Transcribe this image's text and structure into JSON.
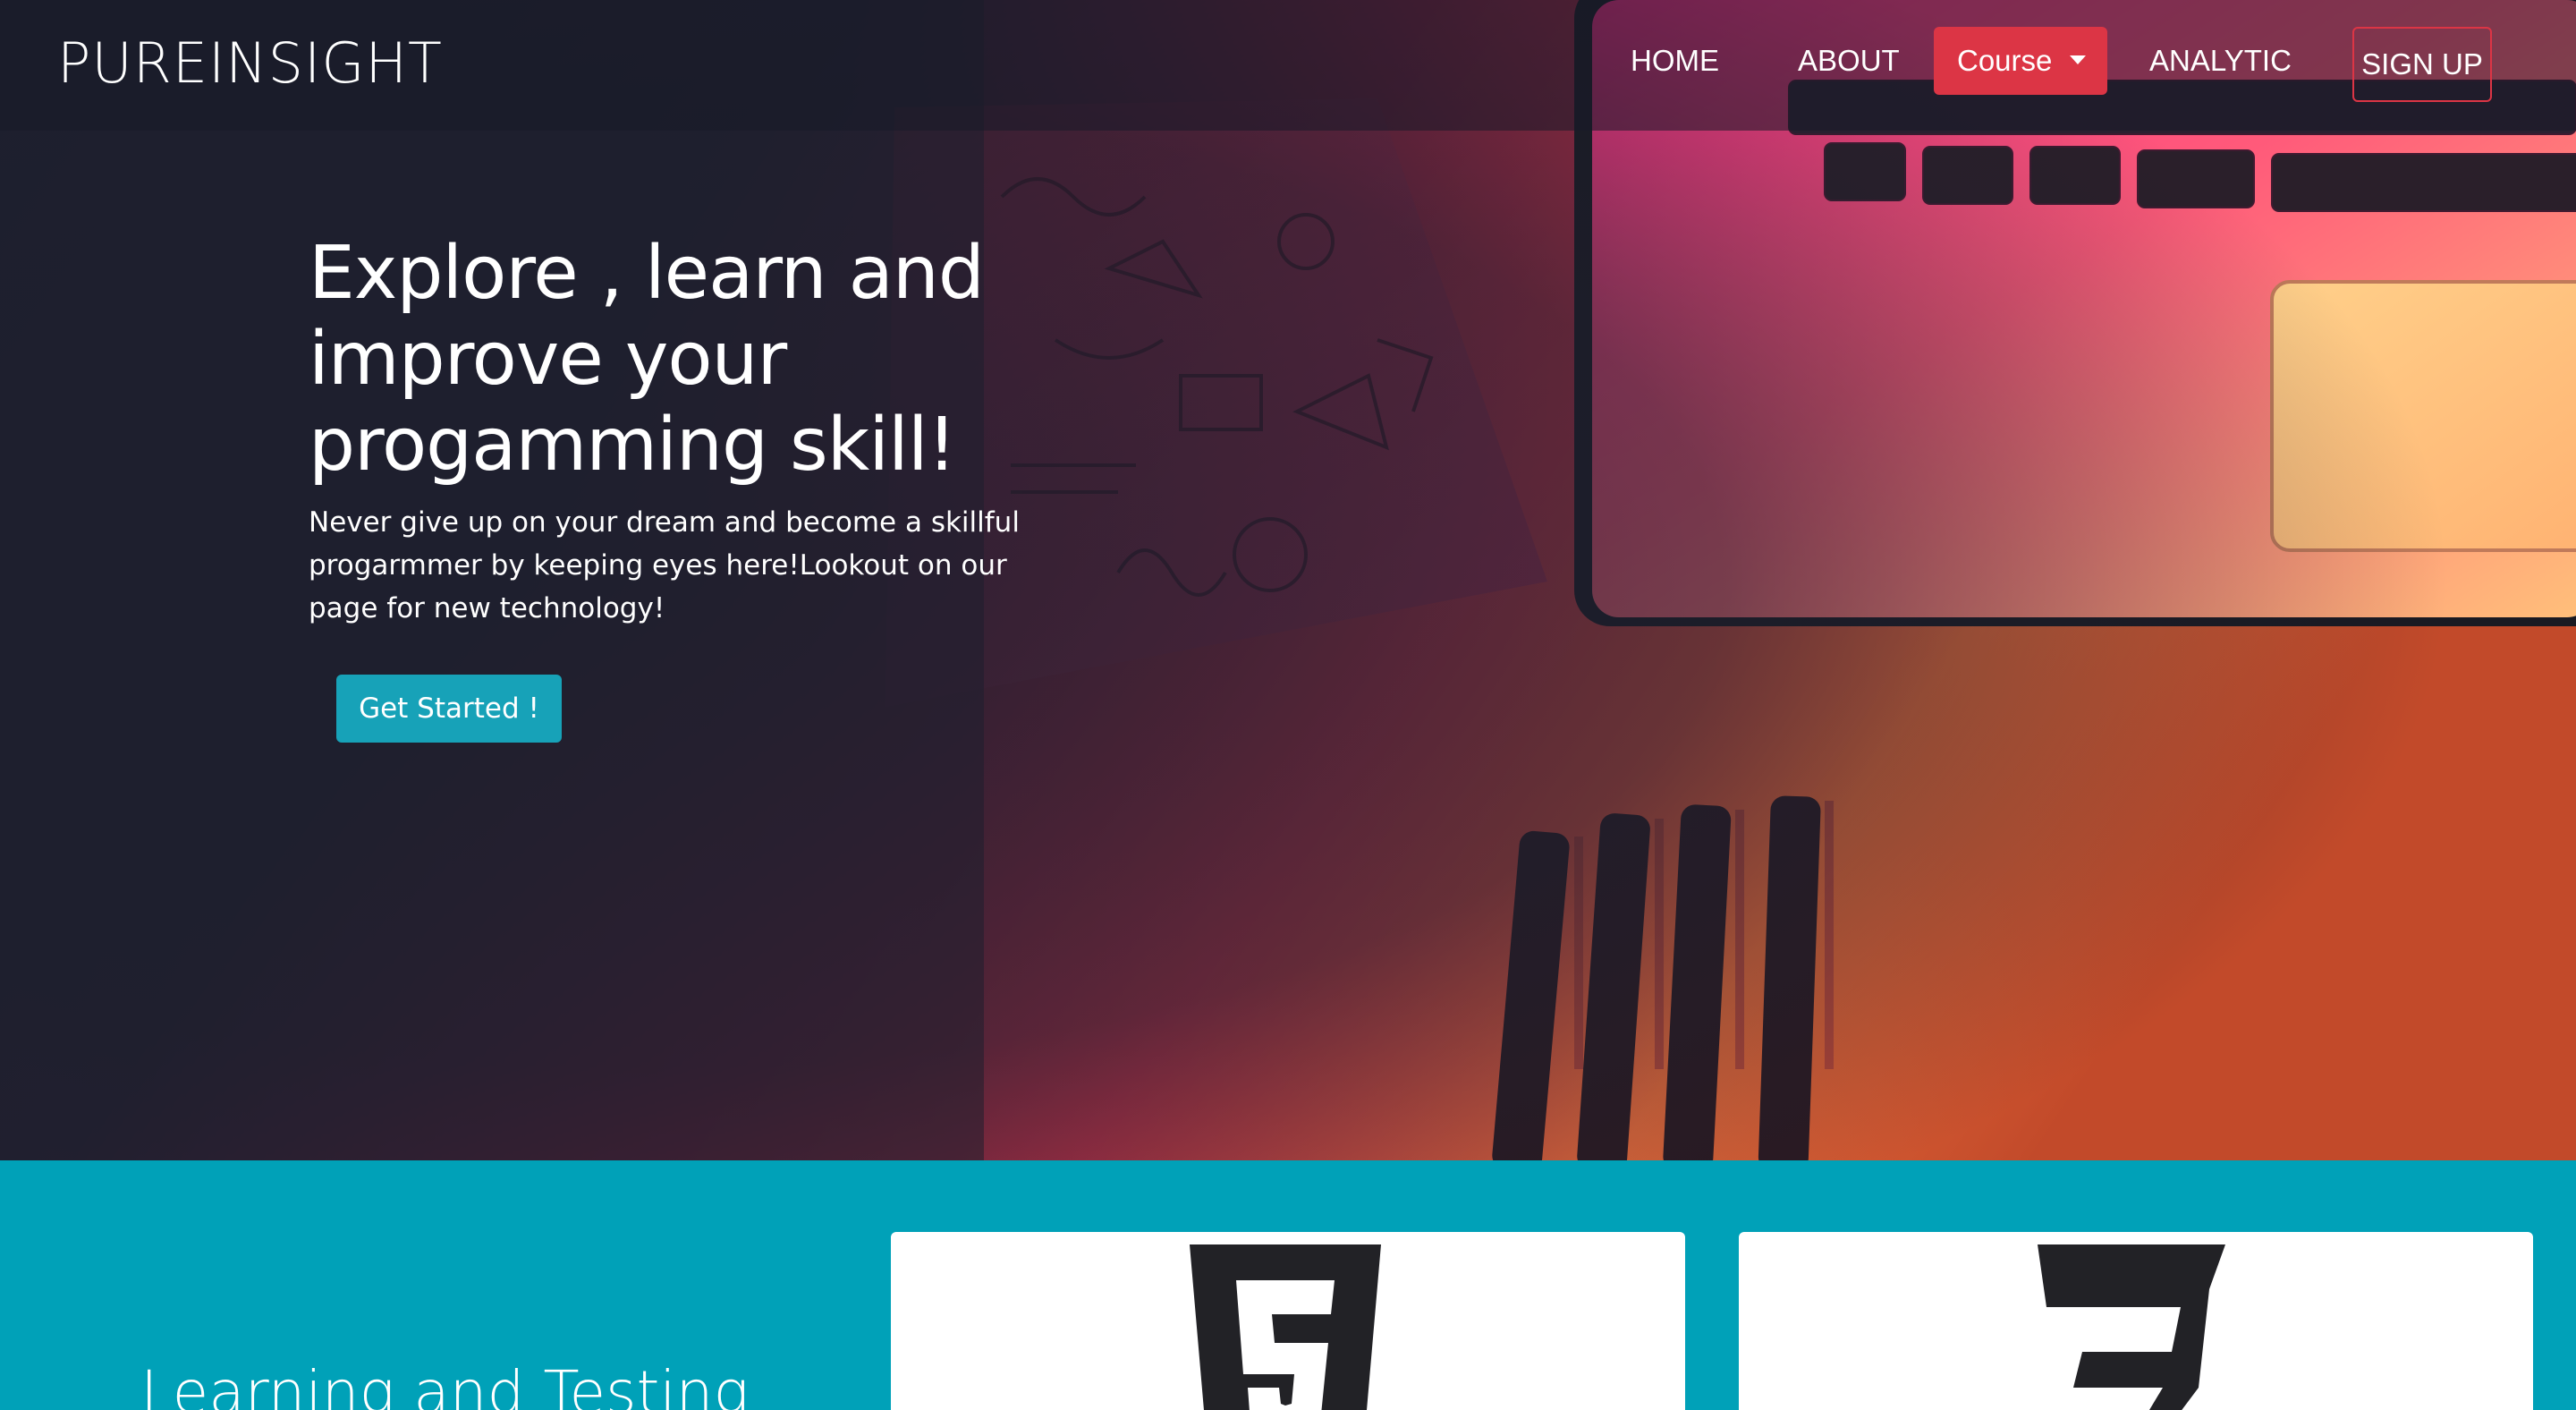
{
  "brand": {
    "name": "PUREINSIGHT"
  },
  "nav": {
    "home": "HOME",
    "about": "ABOUT",
    "course": "Course",
    "analytic": "ANALYTIC",
    "signup": "SIGN UP"
  },
  "hero": {
    "title": "Explore , learn and improve your progamming skill!",
    "subtitle": "Never give up on your dream and become a skillful progarmmer by keeping eyes here!Lookout on our page for new technology!",
    "cta": "Get Started !"
  },
  "section": {
    "title": "Learning and Testing",
    "cards": [
      {
        "icon": "html5-icon"
      },
      {
        "icon": "css3-icon"
      }
    ]
  },
  "colors": {
    "course_button": "#dc3545",
    "signup_border": "#dc3545",
    "cta_button": "#17a2b8",
    "section_background": "#00a1b8",
    "hero_overlay": "#1d1f2e"
  }
}
